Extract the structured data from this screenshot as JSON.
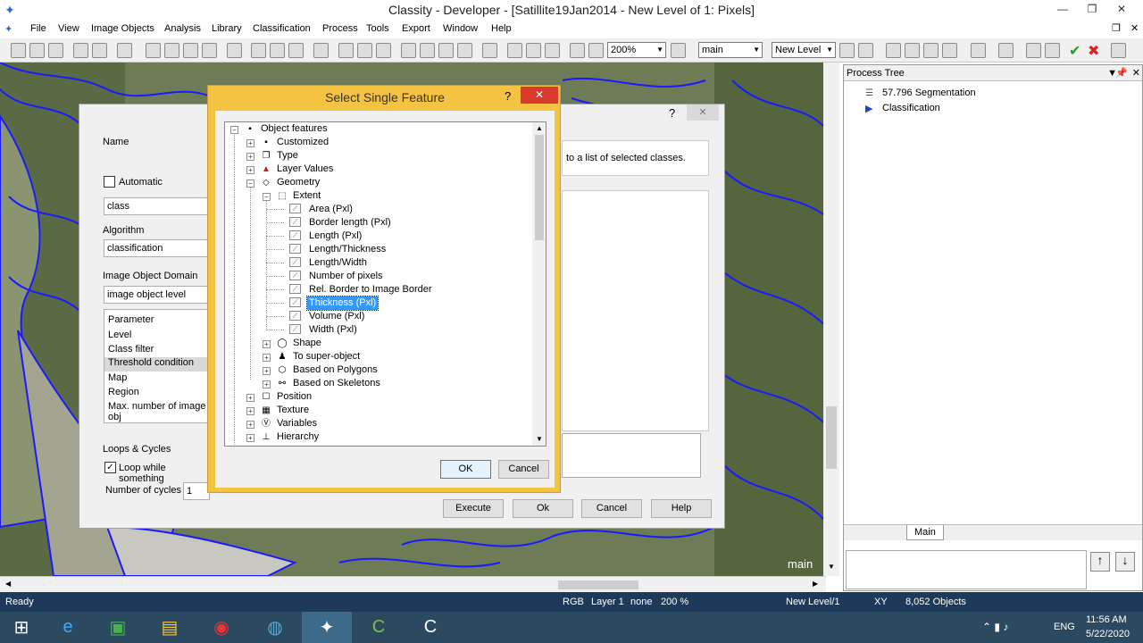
{
  "window": {
    "title": "Classity - Developer - [Satillite19Jan2014 - New Level of 1: Pixels]"
  },
  "menu": [
    "File",
    "View",
    "Image Objects",
    "Analysis",
    "Library",
    "Classification",
    "Process",
    "Tools",
    "Export",
    "Window",
    "Help"
  ],
  "toolbar": {
    "zoom": "200%",
    "map": "main",
    "level": "New Level"
  },
  "map": {
    "label": "main"
  },
  "process_tree": {
    "title": "Process Tree",
    "items": [
      "57.796  Segmentation",
      "Classification"
    ],
    "tab": "Main"
  },
  "edit_dialog": {
    "help": "?",
    "close": "✕",
    "name_label": "Name",
    "automatic_label": "Automatic",
    "name_value": "class",
    "description": "to a list of selected classes.",
    "algorithm_label": "Algorithm",
    "algorithm_value": "classification",
    "domain_label": "Image Object Domain",
    "domain_value": "image object level",
    "params": [
      "Parameter",
      "Level",
      "Class filter",
      "Threshold condition",
      "Map",
      "Region",
      "Max. number of image obj"
    ],
    "loops_label": "Loops & Cycles",
    "loop_label": "Loop while something",
    "cycles_label": "Number of cycles",
    "cycles_value": "1",
    "buttons": {
      "execute": "Execute",
      "ok": "Ok",
      "cancel": "Cancel",
      "help": "Help"
    }
  },
  "select_dialog": {
    "title": "Select Single Feature",
    "help": "?",
    "close": "✕",
    "tree": [
      "Object features",
      "Customized",
      "Type",
      "Layer Values",
      "Geometry",
      "Extent",
      "Area (Pxl)",
      "Border length (Pxl)",
      "Length (Pxl)",
      "Length/Thickness",
      "Length/Width",
      "Number of pixels",
      "Rel. Border to Image Border",
      "Thickness (Pxl)",
      "Volume (Pxl)",
      "Width (Pxl)",
      "Shape",
      "To super-object",
      "Based on Polygons",
      "Based on Skeletons",
      "Position",
      "Texture",
      "Variables",
      "Hierarchy"
    ],
    "selected": "Thickness (Pxl)",
    "ok": "OK",
    "cancel": "Cancel"
  },
  "status": {
    "ready": "Ready",
    "rgb": "RGB",
    "layer": "Layer 1",
    "none": "none",
    "zoom": "200 %",
    "level": "New Level/1",
    "xy": "XY",
    "objects": "8,052 Objects"
  },
  "taskbar": {
    "lang": "ENG",
    "time": "11:56 AM",
    "date": "5/22/2020"
  },
  "colors": {
    "accent": "#3399ff",
    "dialog_border": "#f5c342",
    "status_bg": "#1e3a5a",
    "taskbar_bg": "#2b4a60"
  }
}
